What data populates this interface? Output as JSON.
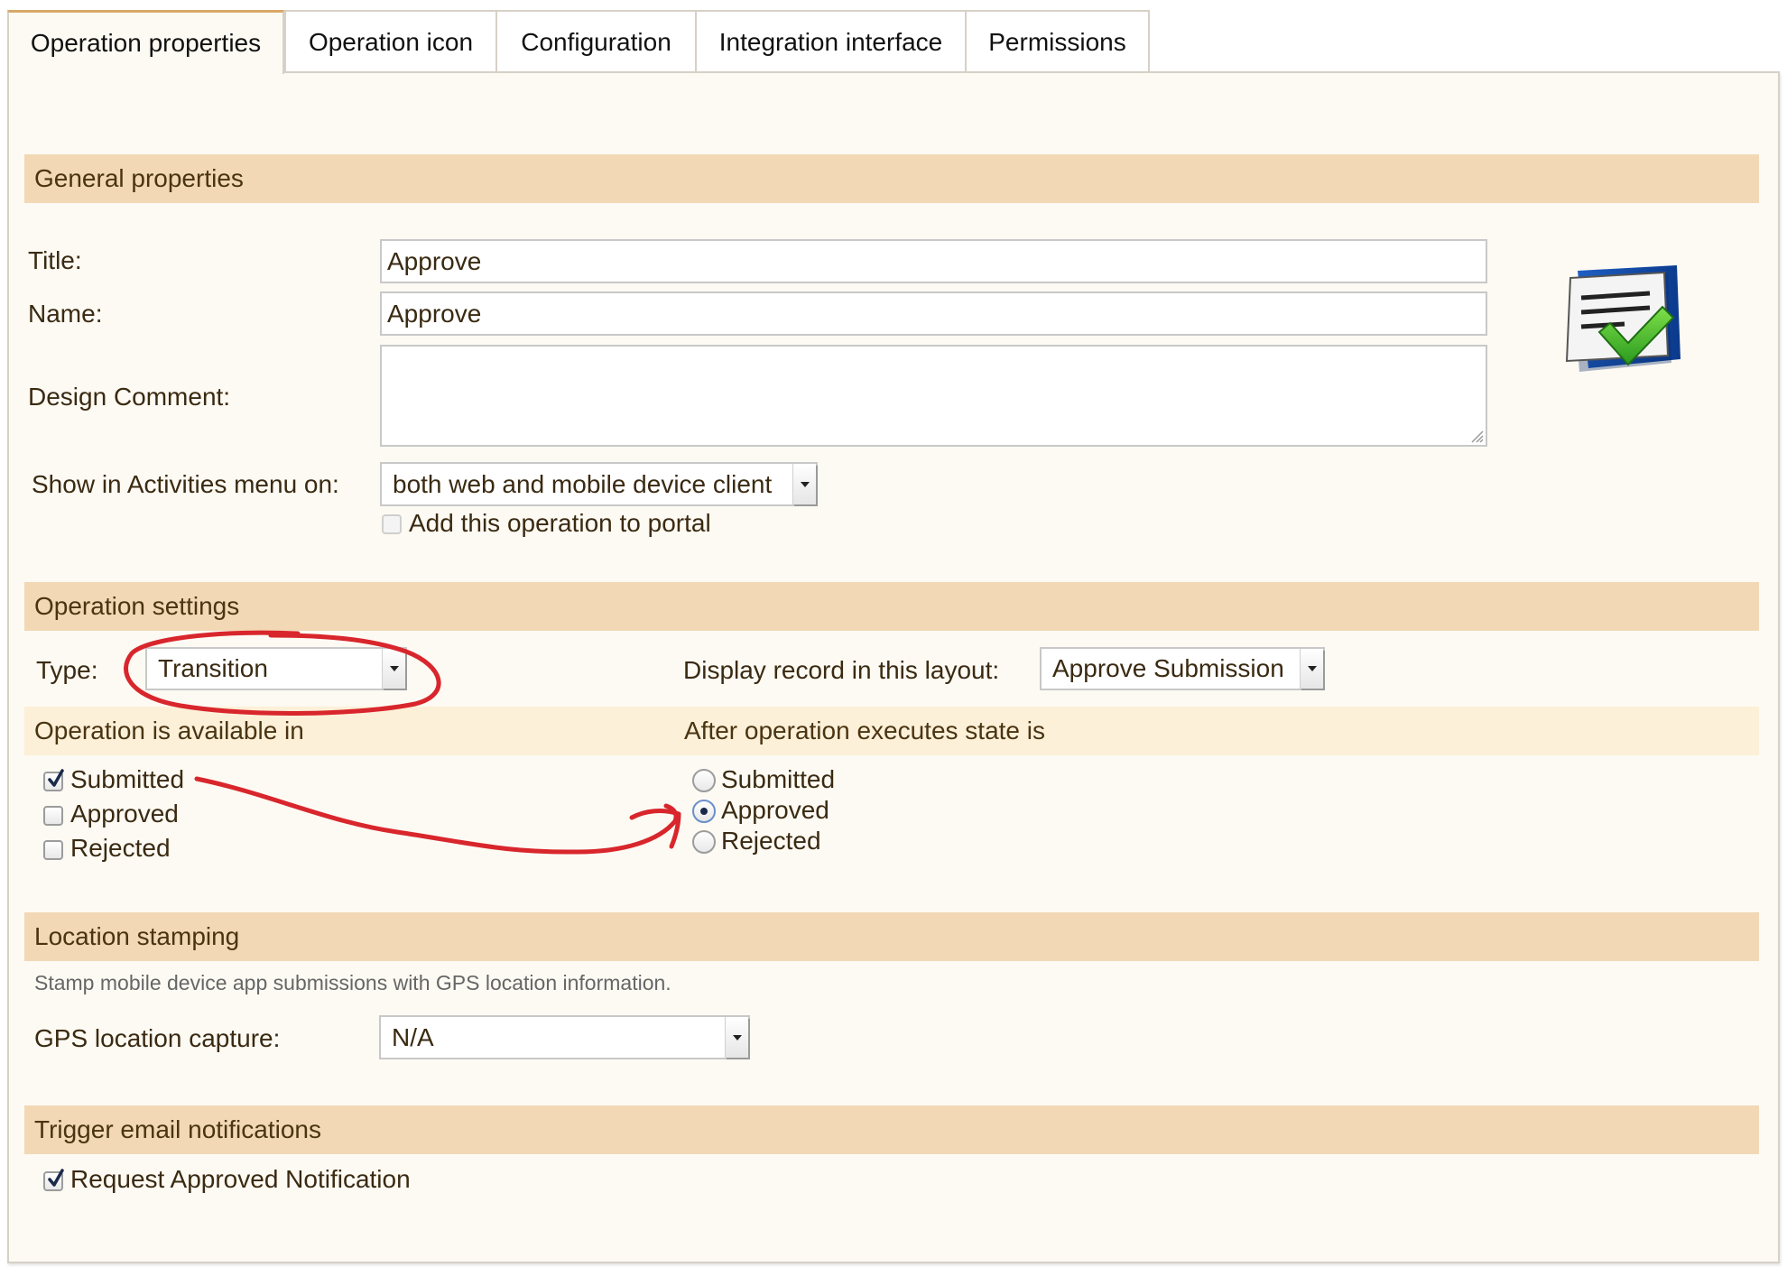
{
  "tabs": [
    {
      "label": "Operation properties",
      "active": true
    },
    {
      "label": "Operation icon",
      "active": false
    },
    {
      "label": "Configuration",
      "active": false
    },
    {
      "label": "Integration interface",
      "active": false
    },
    {
      "label": "Permissions",
      "active": false
    }
  ],
  "general": {
    "heading": "General properties",
    "title_label": "Title:",
    "title_value": "Approve",
    "name_label": "Name:",
    "name_value": "Approve",
    "comment_label": "Design Comment:",
    "comment_value": "",
    "show_label": "Show in Activities menu on:",
    "show_value": "both web and mobile device client",
    "portal_label": "Add this operation to portal",
    "portal_checked": false,
    "icon": "document-approve-icon"
  },
  "settings": {
    "heading": "Operation settings",
    "type_label": "Type:",
    "type_value": "Transition",
    "layout_label": "Display record in this layout:",
    "layout_value": "Approve Submission",
    "available_heading": "Operation is available in",
    "available": [
      {
        "label": "Submitted",
        "checked": true
      },
      {
        "label": "Approved",
        "checked": false
      },
      {
        "label": "Rejected",
        "checked": false
      }
    ],
    "after_heading": "After operation executes state is",
    "after": [
      {
        "label": "Submitted",
        "selected": false
      },
      {
        "label": "Approved",
        "selected": true
      },
      {
        "label": "Rejected",
        "selected": false
      }
    ]
  },
  "location": {
    "heading": "Location stamping",
    "helper": "Stamp mobile device app submissions with GPS location information.",
    "gps_label": "GPS location capture:",
    "gps_value": "N/A"
  },
  "email": {
    "heading": "Trigger email notifications",
    "request_label": "Request Approved Notification",
    "request_checked": true
  },
  "colors": {
    "section_header": "#f2d8b5",
    "sub_header": "#fcf0d8",
    "panel": "#fdfaf3",
    "annotation": "#d8262c",
    "active_tab_border": "#d8a868"
  }
}
